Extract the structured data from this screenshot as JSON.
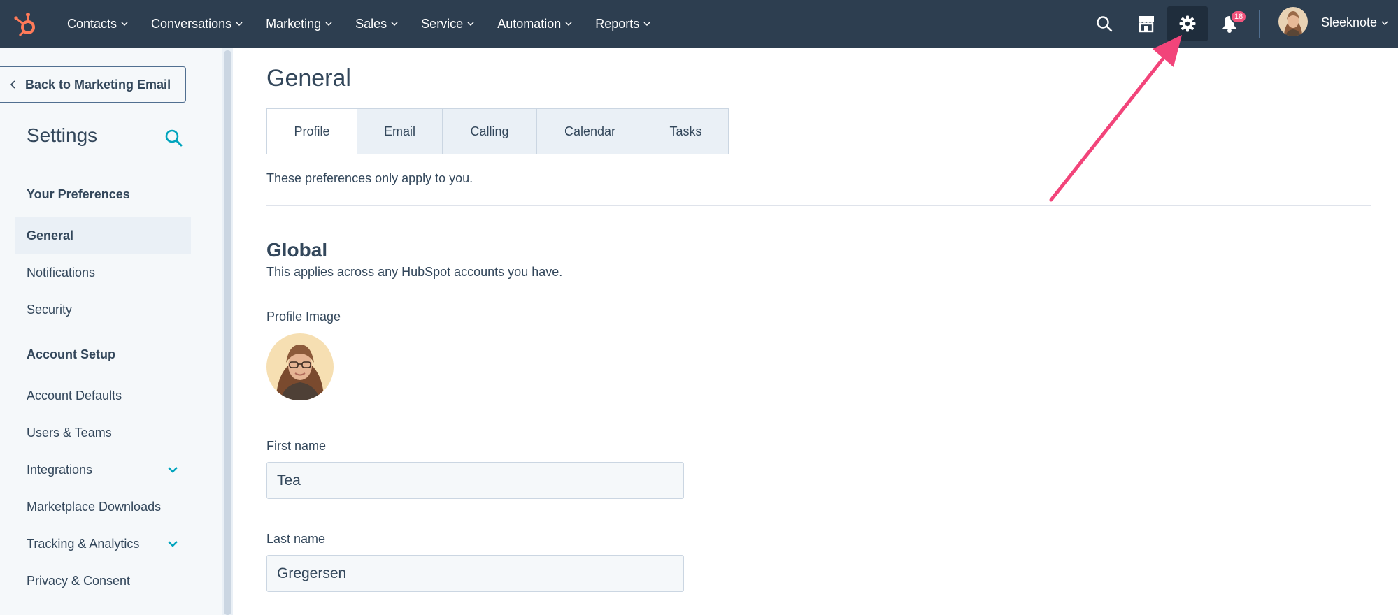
{
  "nav": {
    "items": [
      {
        "label": "Contacts"
      },
      {
        "label": "Conversations"
      },
      {
        "label": "Marketing"
      },
      {
        "label": "Sales"
      },
      {
        "label": "Service"
      },
      {
        "label": "Automation"
      },
      {
        "label": "Reports"
      }
    ],
    "notifications_count": "18",
    "user_name": "Sleeknote",
    "icons": [
      "sprocket-logo-icon",
      "search-icon",
      "marketplace-icon",
      "gear-icon",
      "bell-icon"
    ],
    "colors": {
      "background": "#2d3e50",
      "badge": "#f2547d",
      "logo": "#ff7a59"
    }
  },
  "sidebar": {
    "back_label": "Back to Marketing Email",
    "title": "Settings",
    "sections": [
      {
        "label": "Your Preferences"
      },
      {
        "label": "Account Setup"
      }
    ],
    "items": [
      {
        "label": "General"
      },
      {
        "label": "Notifications"
      },
      {
        "label": "Security"
      },
      {
        "label": "Account Defaults"
      },
      {
        "label": "Users & Teams"
      },
      {
        "label": "Integrations"
      },
      {
        "label": "Marketplace Downloads"
      },
      {
        "label": "Tracking & Analytics"
      },
      {
        "label": "Privacy & Consent"
      }
    ],
    "active_item": "General",
    "colors": {
      "accent": "#00a4bd"
    }
  },
  "main": {
    "title": "General",
    "tabs": [
      {
        "label": "Profile"
      },
      {
        "label": "Email"
      },
      {
        "label": "Calling"
      },
      {
        "label": "Calendar"
      },
      {
        "label": "Tasks"
      }
    ],
    "active_tab": "Profile",
    "note": "These preferences only apply to you.",
    "global": {
      "title": "Global",
      "subtitle": "This applies across any HubSpot accounts you have."
    },
    "profile_image_label": "Profile Image",
    "first_name": {
      "label": "First name",
      "value": "Tea"
    },
    "last_name": {
      "label": "Last name",
      "value": "Gregersen"
    }
  },
  "annotation": {
    "arrow_color": "#f2447a"
  }
}
